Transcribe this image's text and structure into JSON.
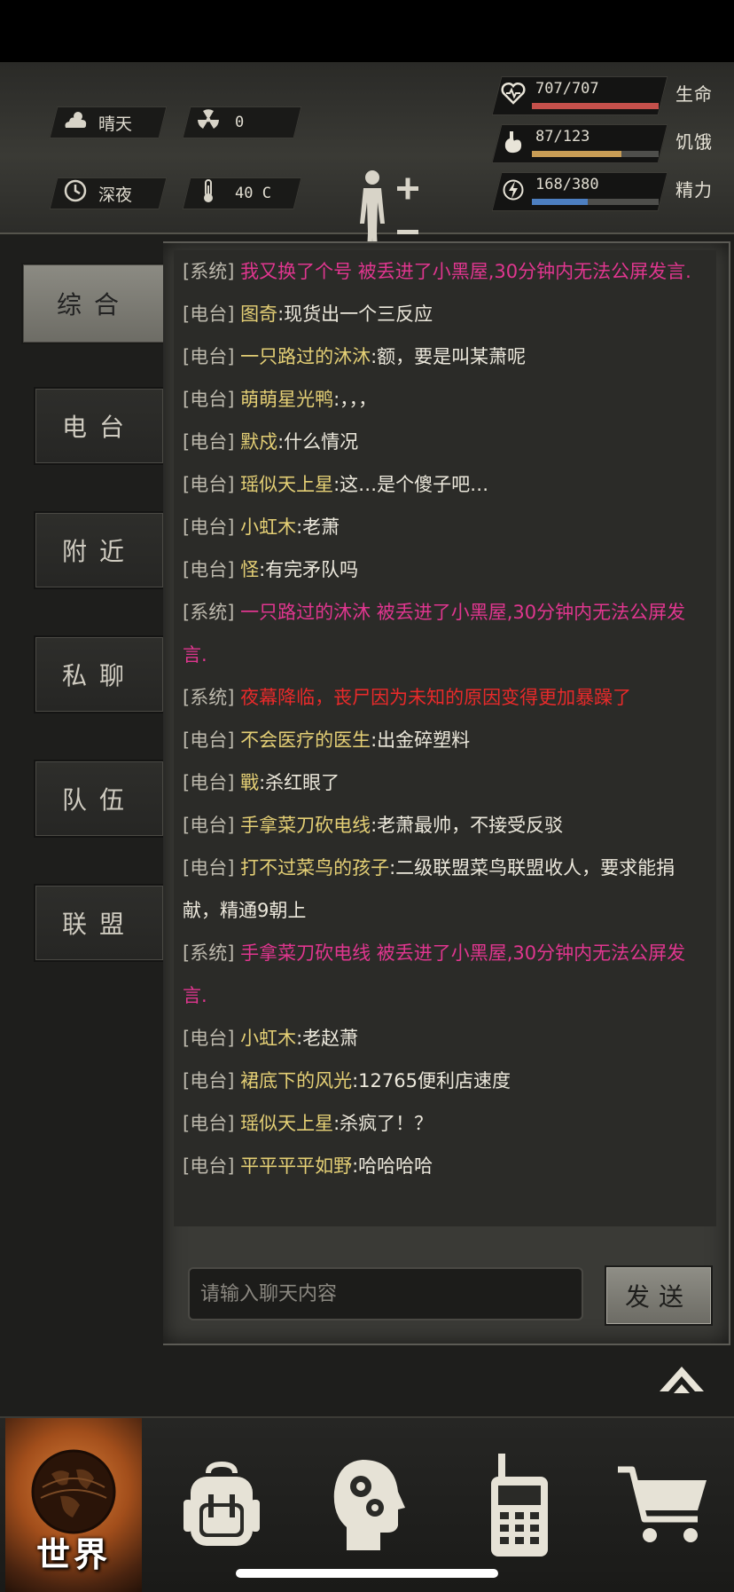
{
  "status": {
    "weather": {
      "icon": "cloud-sun-icon",
      "label": "晴天"
    },
    "radiation": {
      "icon": "radiation-icon",
      "value": "0"
    },
    "time": {
      "icon": "clock-icon",
      "label": "深夜"
    },
    "temperature": {
      "icon": "thermometer-icon",
      "value": "40 C"
    }
  },
  "vitals": {
    "health": {
      "icon": "heart-icon",
      "value": "707/707",
      "label": "生命",
      "fraction": 1.0,
      "color": "#c5504b"
    },
    "hunger": {
      "icon": "stomach-icon",
      "value": "87/123",
      "label": "饥饿",
      "fraction": 0.707,
      "color": "#c99d55"
    },
    "energy": {
      "icon": "energy-icon",
      "value": "168/380",
      "label": "精力",
      "fraction": 0.442,
      "color": "#4d7fc1"
    }
  },
  "tabs": [
    {
      "label": "综合",
      "active": true
    },
    {
      "label": "电台",
      "active": false
    },
    {
      "label": "附近",
      "active": false
    },
    {
      "label": "私聊",
      "active": false
    },
    {
      "label": "队伍",
      "active": false
    },
    {
      "label": "联盟",
      "active": false
    }
  ],
  "messages": [
    {
      "tag": "[系统]",
      "style": "sys-pink",
      "name": "",
      "text": "我又换了个号 被丢进了小黑屋,30分钟内无法公屏发言."
    },
    {
      "tag": "[电台]",
      "style": "radio",
      "name": "图奇",
      "text": ":现货出一个三反应"
    },
    {
      "tag": "[电台]",
      "style": "radio",
      "name": "一只路过的沐沐",
      "text": ":额，要是叫某萧呢"
    },
    {
      "tag": "[电台]",
      "style": "radio",
      "name": "萌萌星光鸭",
      "text": ":，，，"
    },
    {
      "tag": "[电台]",
      "style": "radio",
      "name": "默戍",
      "text": ":什么情况"
    },
    {
      "tag": "[电台]",
      "style": "radio",
      "name": "瑶似天上星",
      "text": ":这…是个傻子吧…"
    },
    {
      "tag": "[电台]",
      "style": "radio",
      "name": "小虹木",
      "text": ":老萧"
    },
    {
      "tag": "[电台]",
      "style": "radio",
      "name": "怪",
      "text": ":有完矛队吗"
    },
    {
      "tag": "[系统]",
      "style": "sys-pink",
      "name": "",
      "text": "一只路过的沐沐 被丢进了小黑屋,30分钟内无法公屏发言."
    },
    {
      "tag": "[系统]",
      "style": "sys-red",
      "name": "",
      "text": "夜幕降临，丧尸因为未知的原因变得更加暴躁了"
    },
    {
      "tag": "[电台]",
      "style": "radio",
      "name": "不会医疗的医生",
      "text": ":出金碎塑料"
    },
    {
      "tag": "[电台]",
      "style": "radio",
      "name": "戰",
      "text": ":杀红眼了"
    },
    {
      "tag": "[电台]",
      "style": "radio",
      "name": "手拿菜刀砍电线",
      "text": ":老萧最帅，不接受反驳"
    },
    {
      "tag": "[电台]",
      "style": "radio",
      "name": "打不过菜鸟的孩子",
      "text": ":二级联盟菜鸟联盟收人，要求能捐献，精通9朝上"
    },
    {
      "tag": "[系统]",
      "style": "sys-pink",
      "name": "",
      "text": "手拿菜刀砍电线 被丢进了小黑屋,30分钟内无法公屏发言."
    },
    {
      "tag": "[电台]",
      "style": "radio",
      "name": "小虹木",
      "text": ":老赵萧"
    },
    {
      "tag": "[电台]",
      "style": "radio",
      "name": "裙底下的风光",
      "text": ":12765便利店速度"
    },
    {
      "tag": "[电台]",
      "style": "radio",
      "name": "瑶似天上星",
      "text": ":杀疯了！？"
    },
    {
      "tag": "[电台]",
      "style": "radio",
      "name": "平平平平如野",
      "text": ":哈哈哈哈"
    }
  ],
  "input": {
    "placeholder": "请输入聊天内容"
  },
  "send_label": "发送",
  "nav": [
    {
      "name": "nav-world",
      "icon": "globe-icon",
      "label": "世界",
      "active": true
    },
    {
      "name": "nav-backpack",
      "icon": "backpack-icon",
      "label": "",
      "active": false
    },
    {
      "name": "nav-skills",
      "icon": "brain-gears-icon",
      "label": "",
      "active": false
    },
    {
      "name": "nav-radio",
      "icon": "walkie-talkie-icon",
      "label": "",
      "active": false
    },
    {
      "name": "nav-shop",
      "icon": "cart-icon",
      "label": "",
      "active": false
    }
  ]
}
